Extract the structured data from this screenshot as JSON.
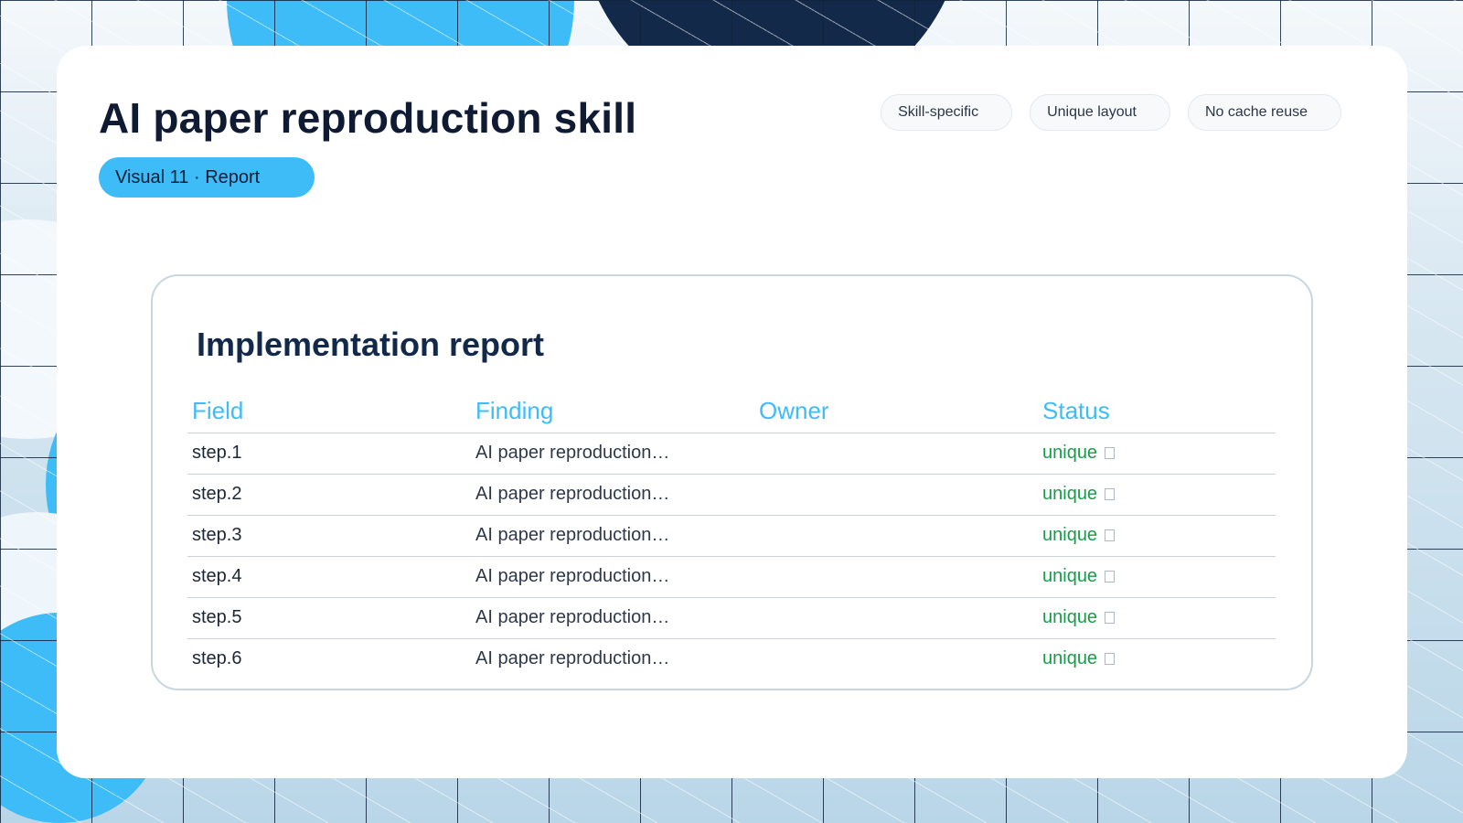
{
  "page": {
    "title": "AI paper reproduction skill",
    "visual_label": "Visual 11 · Report",
    "tags": [
      "Skill-specific",
      "Unique layout",
      "No cache reuse"
    ]
  },
  "report": {
    "title": "Implementation report",
    "columns": [
      "Field",
      "Finding",
      "Owner",
      "Status"
    ],
    "rows": [
      {
        "field": "step.1",
        "finding": "AI paper reproduction…",
        "owner": "",
        "status": "unique"
      },
      {
        "field": "step.2",
        "finding": "AI paper reproduction…",
        "owner": "",
        "status": "unique"
      },
      {
        "field": "step.3",
        "finding": "AI paper reproduction…",
        "owner": "",
        "status": "unique"
      },
      {
        "field": "step.4",
        "finding": "AI paper reproduction…",
        "owner": "",
        "status": "unique"
      },
      {
        "field": "step.5",
        "finding": "AI paper reproduction…",
        "owner": "",
        "status": "unique"
      },
      {
        "field": "step.6",
        "finding": "AI paper reproduction…",
        "owner": "",
        "status": "unique"
      }
    ]
  },
  "colors": {
    "accent": "#3ebcf7",
    "navy": "#12294a",
    "status_ok": "#1a9b4a",
    "card": "#ffffff"
  },
  "icons": {
    "status_glyph": "missing-glyph-icon"
  }
}
